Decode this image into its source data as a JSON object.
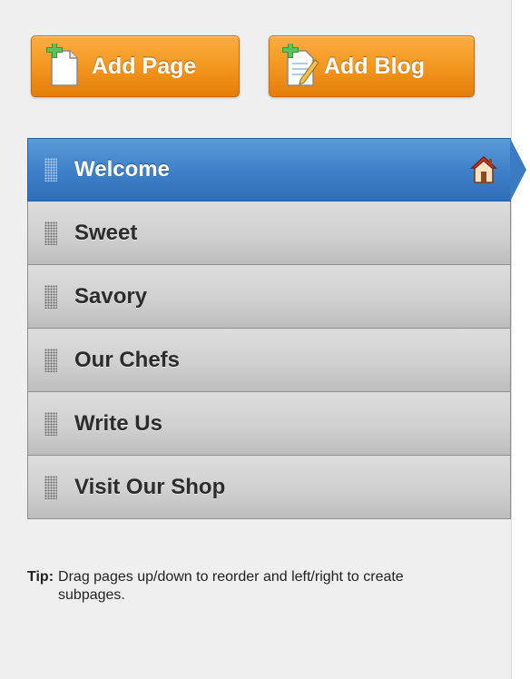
{
  "actions": {
    "add_page_label": "Add Page",
    "add_blog_label": "Add Blog",
    "accent_color": "#f49a22",
    "add_page_icon": "page-add-icon",
    "add_blog_icon": "blog-add-icon"
  },
  "pages": {
    "active_color": "#3d80c9",
    "items": [
      {
        "label": "Welcome",
        "active": true,
        "home": true
      },
      {
        "label": "Sweet"
      },
      {
        "label": "Savory"
      },
      {
        "label": "Our Chefs"
      },
      {
        "label": "Write Us"
      },
      {
        "label": "Visit Our Shop"
      }
    ],
    "grip_icon": "drag-handle-icon",
    "home_icon": "home-icon"
  },
  "tip": {
    "label": "Tip:",
    "text": "Drag pages up/down to reorder and left/right to create subpages."
  }
}
